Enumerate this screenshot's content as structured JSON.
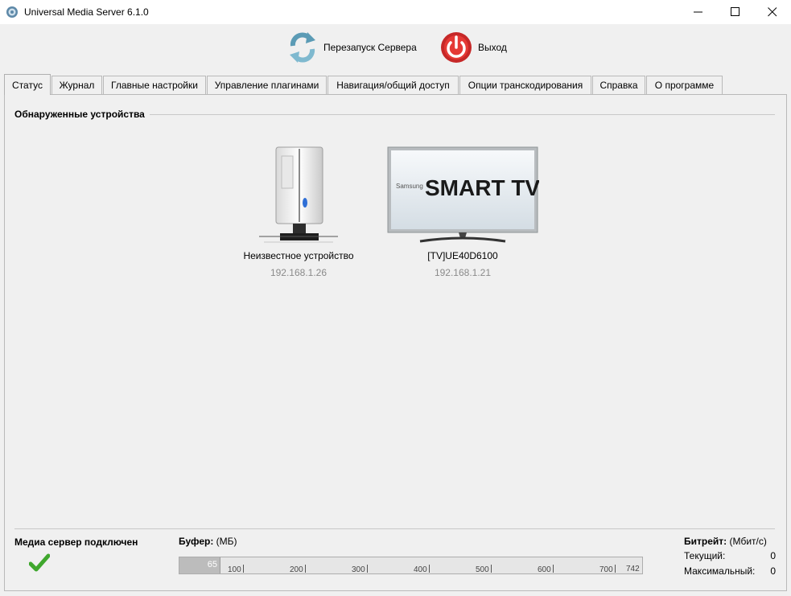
{
  "window": {
    "title": "Universal Media Server 6.1.0"
  },
  "toolbar": {
    "restart_label": "Перезапуск Сервера",
    "exit_label": "Выход"
  },
  "tabs": [
    {
      "label": "Статус",
      "active": true
    },
    {
      "label": "Журнал"
    },
    {
      "label": "Главные настройки"
    },
    {
      "label": "Управление плагинами"
    },
    {
      "label": "Навигация/общий доступ"
    },
    {
      "label": "Опции транскодирования"
    },
    {
      "label": "Справка"
    },
    {
      "label": "О программе"
    }
  ],
  "devices_section": {
    "title": "Обнаруженные устройства",
    "devices": [
      {
        "name": "Неизвестное устройство",
        "ip": "192.168.1.26",
        "icon": "media-server-device-icon"
      },
      {
        "name": "[TV]UE40D6100",
        "ip": "192.168.1.21",
        "icon": "samsung-smart-tv-icon",
        "brand_small": "Samsung",
        "brand_large": "SMART TV"
      }
    ]
  },
  "status": {
    "connected_label": "Медиа сервер подключен",
    "icon": "checkmark-icon",
    "icon_color": "#3fa72d"
  },
  "buffer": {
    "label": "Буфер:",
    "unit": "(МБ)",
    "value": "65",
    "max": 742,
    "fraction": 0.0876,
    "ticks": [
      "100",
      "200",
      "300",
      "400",
      "500",
      "600",
      "700",
      "742"
    ]
  },
  "bitrate": {
    "label": "Битрейт:",
    "unit": "(Мбит/с)",
    "current_label": "Текущий:",
    "current_value": "0",
    "max_label": "Максимальный:",
    "max_value": "0"
  }
}
